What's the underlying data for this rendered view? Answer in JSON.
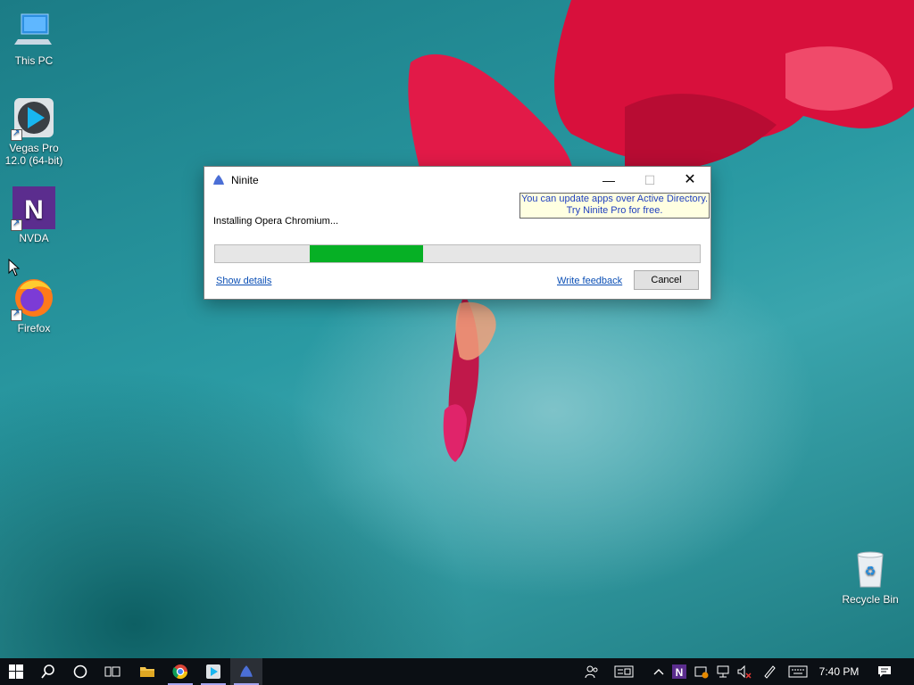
{
  "desktop": {
    "icons": [
      {
        "label": "This PC"
      },
      {
        "label": "Vegas Pro 12.0 (64-bit)"
      },
      {
        "label": "NVDA"
      },
      {
        "label": "Firefox"
      },
      {
        "label": "Recycle Bin"
      }
    ]
  },
  "window": {
    "title": "Ninite",
    "minimize_glyph": "—",
    "maximize_glyph": "☐",
    "close_glyph": "✕",
    "tooltip_line1": "You can update apps over Active Directory.",
    "tooltip_line2": "Try Ninite Pro for free.",
    "status": "Installing Opera Chromium...",
    "progress": {
      "start_fraction": 0.195,
      "end_fraction": 0.43,
      "color": "#06b025"
    },
    "show_details": "Show details",
    "write_feedback": "Write feedback",
    "cancel": "Cancel"
  },
  "taskbar": {
    "clock": "7:40 PM",
    "icons": [
      "windows-start-icon",
      "search-icon",
      "cortana-icon",
      "task-view-icon",
      "file-explorer-icon",
      "chrome-icon",
      "vegas-icon",
      "ninite-icon"
    ],
    "tray_icons": [
      "people-icon",
      "news-icon",
      "chevron-up-icon",
      "nvda-tray-icon",
      "update-icon",
      "network-icon",
      "volume-muted-icon",
      "pen-icon",
      "keyboard-icon",
      "notification-icon"
    ]
  }
}
